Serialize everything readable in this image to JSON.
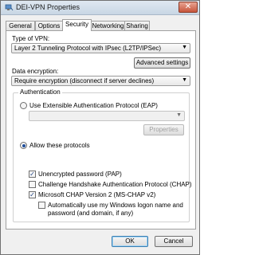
{
  "window": {
    "title": "DEI-VPN Properties",
    "close_label": "✕"
  },
  "tabs": [
    {
      "label": "General"
    },
    {
      "label": "Options"
    },
    {
      "label": "Security"
    },
    {
      "label": "Networking"
    },
    {
      "label": "Sharing"
    }
  ],
  "vpn_type": {
    "label": "Type of VPN:",
    "value": "Layer 2 Tunneling Protocol with IPsec (L2TP/IPSec)"
  },
  "advanced_button": "Advanced settings",
  "data_encryption": {
    "label": "Data encryption:",
    "value": "Require encryption (disconnect if server declines)"
  },
  "authentication": {
    "group_title": "Authentication",
    "eap_radio": "Use Extensible Authentication Protocol (EAP)",
    "eap_value": "",
    "properties_button": "Properties",
    "allow_radio": "Allow these protocols",
    "protocols": [
      {
        "label": "Unencrypted password (PAP)",
        "checked": true
      },
      {
        "label": "Challenge Handshake Authentication Protocol (CHAP)",
        "checked": false
      },
      {
        "label": "Microsoft CHAP Version 2 (MS-CHAP v2)",
        "checked": true
      }
    ],
    "auto_logon": {
      "line1": "Automatically use my Windows logon name and",
      "line2": "password (and domain, if any)",
      "checked": false
    }
  },
  "footer": {
    "ok": "OK",
    "cancel": "Cancel"
  }
}
